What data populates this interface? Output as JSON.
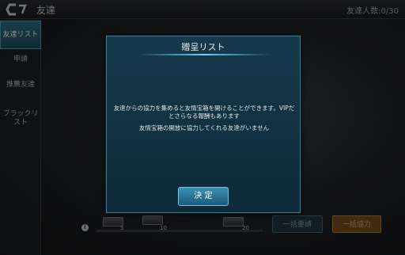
{
  "topbar": {
    "title": "友達",
    "friend_count": "友達人数:0/30"
  },
  "sidebar": {
    "items": [
      {
        "label": "友達リスト",
        "active": true
      },
      {
        "label": "申請",
        "active": false
      },
      {
        "label": "推薦友達",
        "active": false
      },
      {
        "label": "ブラックリ\nスト",
        "active": false
      }
    ]
  },
  "rewards": {
    "ticks": [
      "5",
      "10",
      "20"
    ]
  },
  "bottom": {
    "request_all": "一括要請",
    "help_all": "一括協力"
  },
  "dialog": {
    "title": "贈呈リスト",
    "message1": "友達からの協力を集めると友情宝箱を開けることができます。VIPだとさらなる報酬もあります",
    "message2": "友情宝箱の開放に協力してくれる友達がいません",
    "ok": "決 定"
  },
  "colors": {
    "accent": "#6fd3ff",
    "dialog_bg": "#16394c",
    "active_tab": "#2f6f86"
  }
}
